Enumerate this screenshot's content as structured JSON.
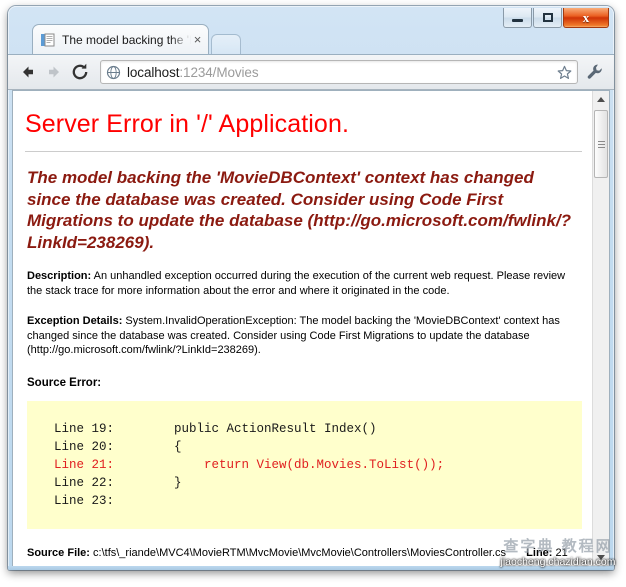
{
  "window": {
    "controls": {
      "minimize_label": "Minimize",
      "maximize_label": "Maximize",
      "close_label": "x"
    },
    "accent_close_color": "#cf3307"
  },
  "tab": {
    "title": "The model backing the 'M",
    "close_label": "×",
    "favicon": "document-favicon",
    "new_tab_label": ""
  },
  "toolbar": {
    "back_label": "Back",
    "forward_label": "Forward",
    "reload_label": "Reload",
    "url_host": "localhost",
    "url_rest": ":1234/Movies",
    "star_label": "Bookmark this page",
    "wrench_label": "Customize and control Google Chrome"
  },
  "page": {
    "title": "Server Error in '/' Application.",
    "title_color": "#ff0000",
    "message": "The model backing the 'MovieDBContext' context has changed since the database was created. Consider using Code First Migrations to update the database (http://go.microsoft.com/fwlink/?LinkId=238269).",
    "message_color": "#8b1a10",
    "description_label": "Description:",
    "description_text": "An unhandled exception occurred during the execution of the current web request. Please review the stack trace for more information about the error and where it originated in the code.",
    "exception_label": "Exception Details:",
    "exception_text": "System.InvalidOperationException: The model backing the 'MovieDBContext' context has changed since the database was created. Consider using Code First Migrations to update the database (http://go.microsoft.com/fwlink/?LinkId=238269).",
    "source_error_label": "Source Error:",
    "code_background": "#ffffcc",
    "code_lines": [
      {
        "number": "Line 19:",
        "text": "        public ActionResult Index()",
        "highlighted": false
      },
      {
        "number": "Line 20:",
        "text": "        {",
        "highlighted": false
      },
      {
        "number": "Line 21:",
        "text": "            return View(db.Movies.ToList());",
        "highlighted": true
      },
      {
        "number": "Line 22:",
        "text": "        }",
        "highlighted": false
      },
      {
        "number": "Line 23:",
        "text": "",
        "highlighted": false
      }
    ],
    "highlight_color": "#e02020",
    "source_file_label": "Source File:",
    "source_file_path": "c:\\tfs\\_riande\\MVC4\\MovieRTM\\MvcMovie\\MvcMovie\\Controllers\\MoviesController.cs",
    "line_label": "Line:",
    "line_value": "21"
  },
  "scrollbar": {
    "up_label": "Scroll up",
    "down_label": "Scroll down"
  },
  "watermark": {
    "chinese": "查字典 教程网",
    "url": "jiaocheng.chazidian.com"
  }
}
